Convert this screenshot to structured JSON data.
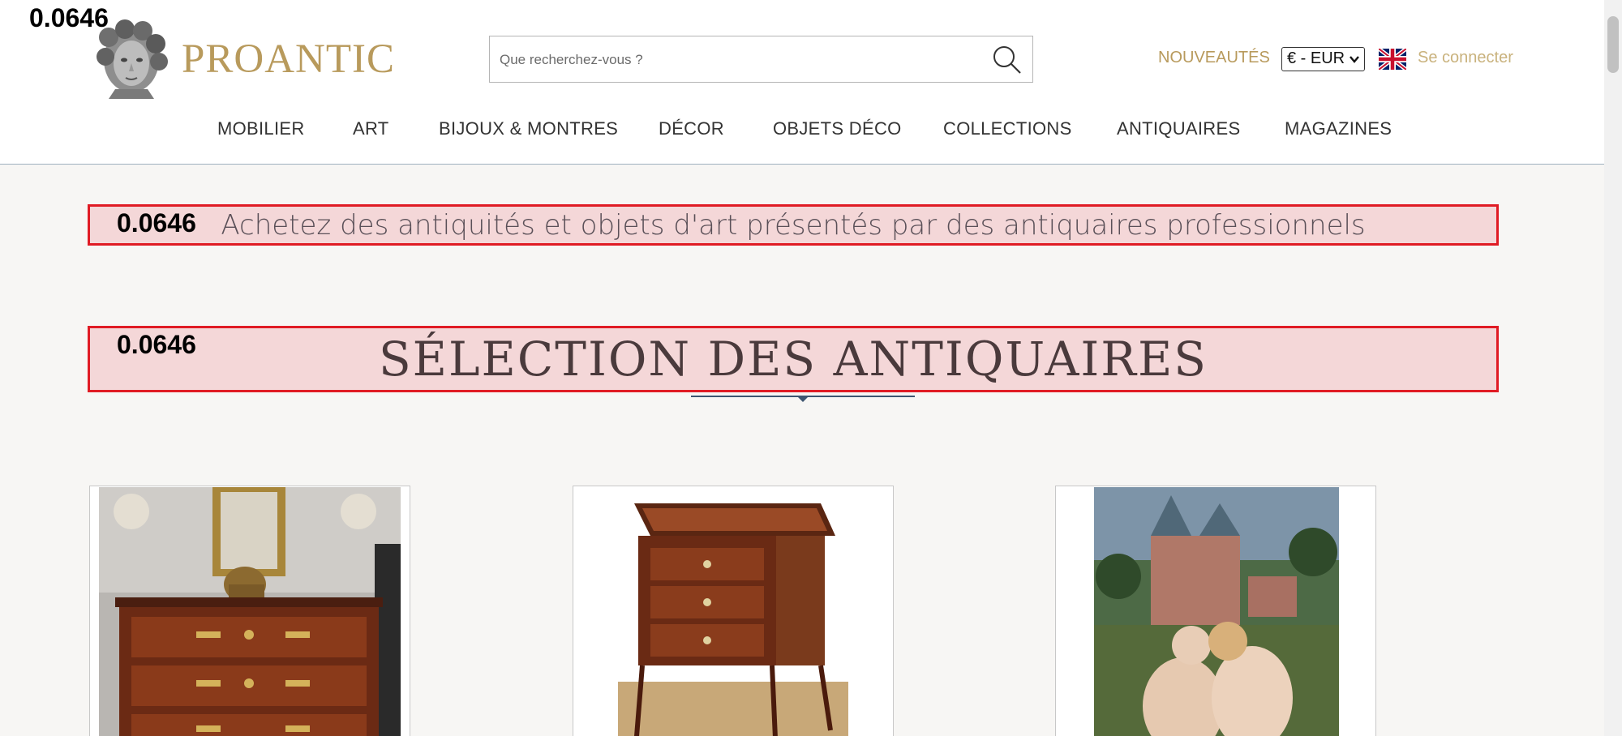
{
  "overlay": {
    "score_top": "0.0646",
    "score_tagline": "0.0646",
    "score_section": "0.0646"
  },
  "header": {
    "brand": "PROANTIC",
    "search_placeholder": "Que recherchez-vous ?",
    "new_label": "NOUVEAUTÉS",
    "currency": "€ - EUR",
    "login_label": "Se connecter",
    "language_flag": "uk-flag-icon"
  },
  "nav": {
    "items": [
      "MOBILIER",
      "ART",
      "BIJOUX & MONTRES",
      "DÉCOR",
      "OBJETS DÉCO",
      "COLLECTIONS",
      "ANTIQUAIRES",
      "MAGAZINES"
    ]
  },
  "hero": {
    "tagline": "Achetez des antiquités et objets d'art présentés par des antiquaires professionnels"
  },
  "section": {
    "title": "SÉLECTION DES ANTIQUAIRES"
  },
  "colors": {
    "brand_gold": "#b89a5c",
    "highlight_red": "#e01b24",
    "divider_blue": "#3d5570"
  }
}
